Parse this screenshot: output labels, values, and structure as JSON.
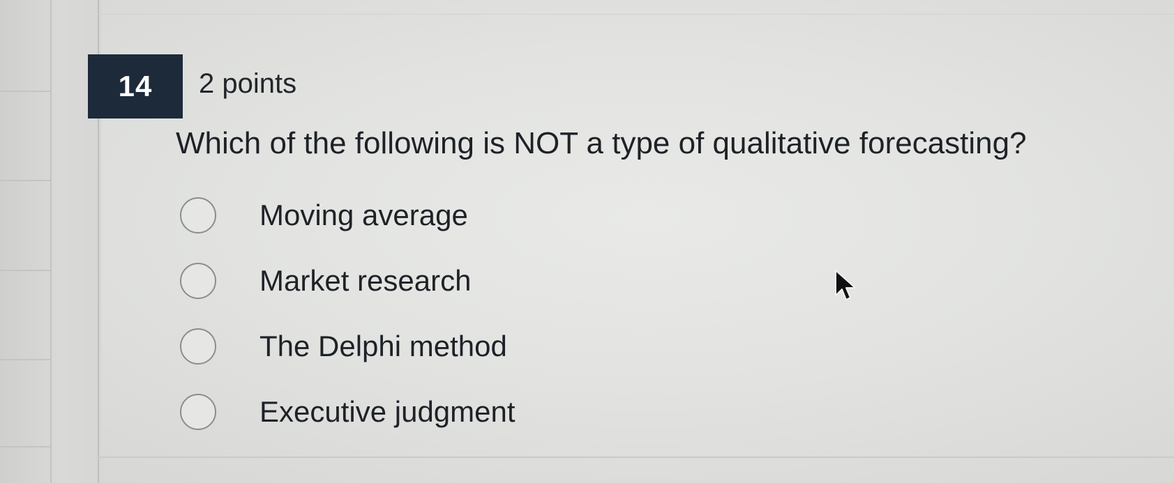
{
  "question": {
    "number": "14",
    "points": "2 points",
    "text": "Which of the following is NOT a type of qualitative forecasting?"
  },
  "options": [
    {
      "label": "Moving average",
      "selected": false
    },
    {
      "label": "Market research",
      "selected": false
    },
    {
      "label": "The Delphi method",
      "selected": false
    },
    {
      "label": "Executive judgment",
      "selected": false
    }
  ],
  "icons": {
    "cursor": "mouse-pointer-icon"
  },
  "colors": {
    "number_badge_bg": "#1d2a3a",
    "background": "#e2e3e1",
    "text": "#1e2227"
  }
}
